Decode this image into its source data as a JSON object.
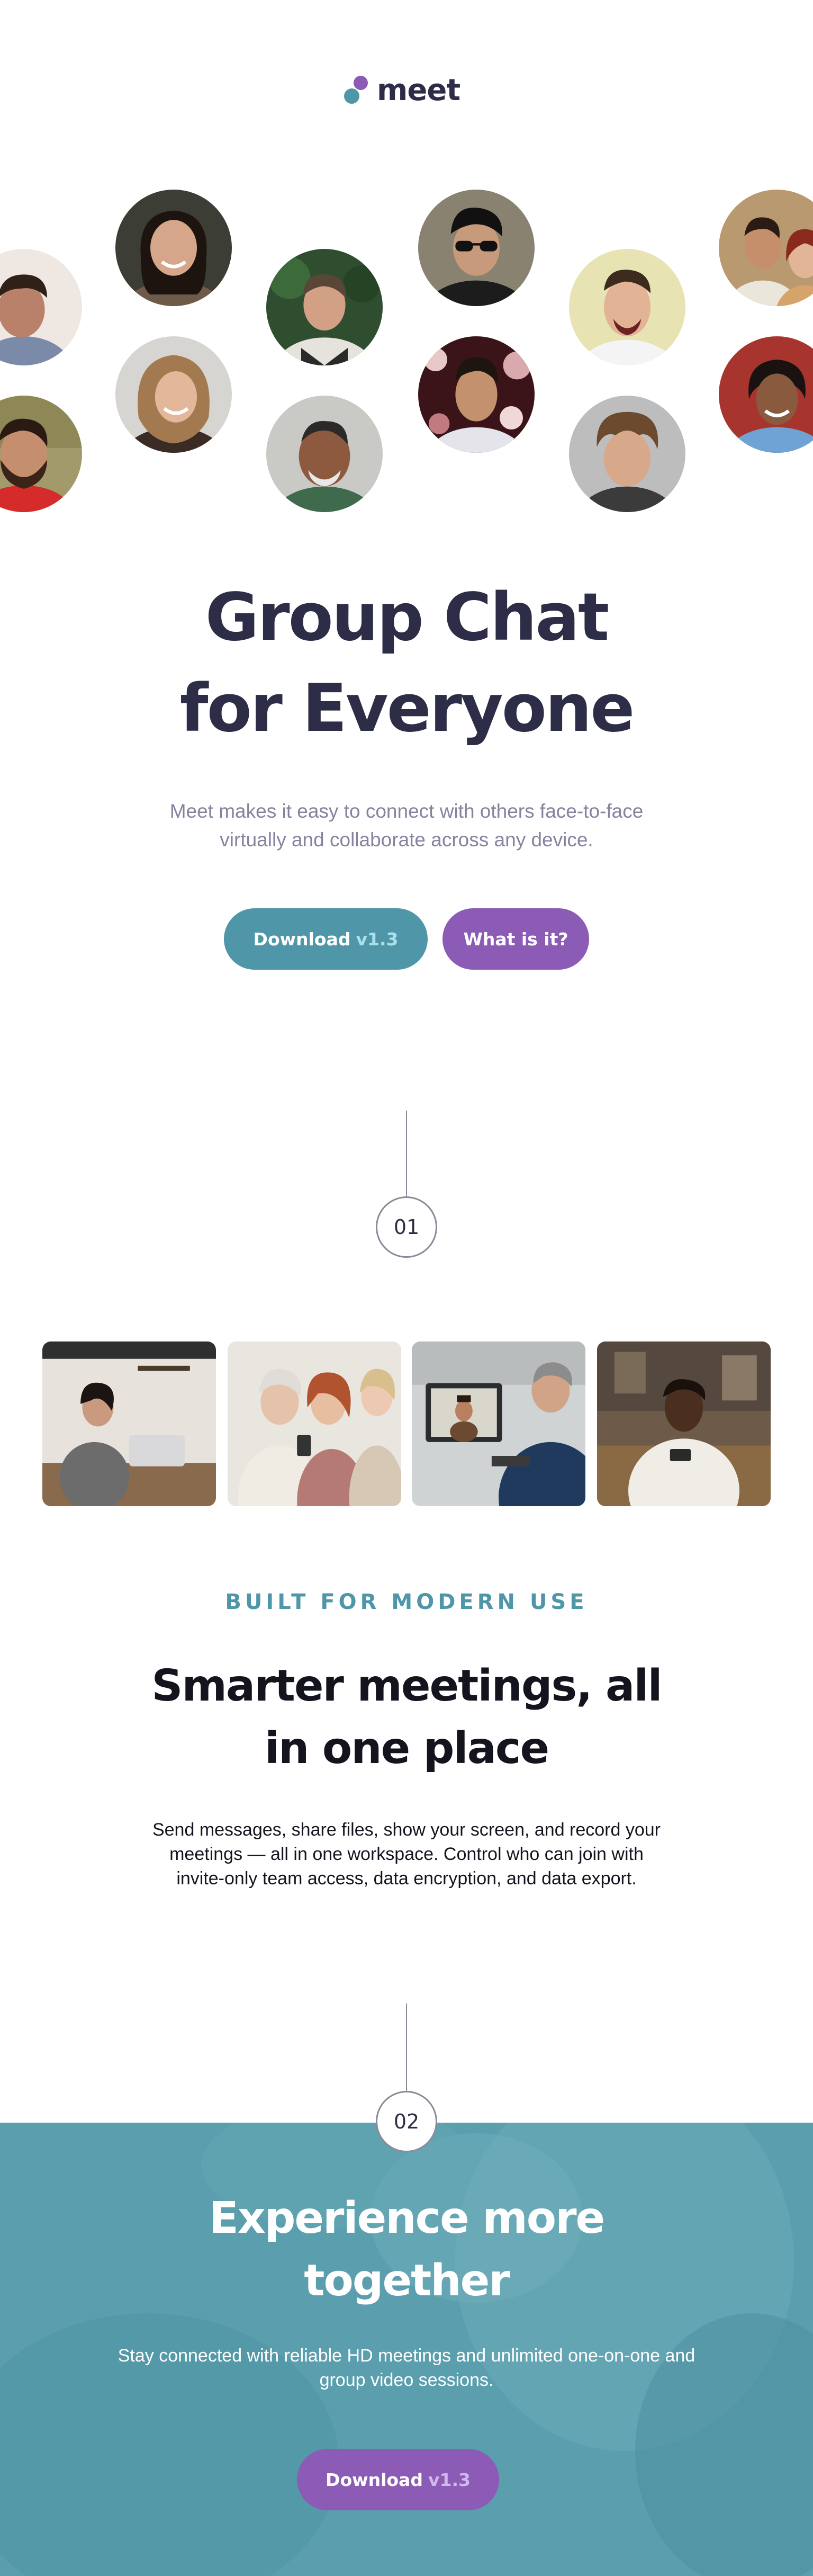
{
  "brand": {
    "name": "meet",
    "colors": {
      "teal": "#4f97a8",
      "purple": "#8b5bb5",
      "dark": "#2d2d47",
      "muted": "#86839e"
    }
  },
  "avatars": [
    {
      "name": "avatar-boy-left"
    },
    {
      "name": "avatar-bearded-man-left"
    },
    {
      "name": "avatar-woman-smiling"
    },
    {
      "name": "avatar-woman-blonde"
    },
    {
      "name": "avatar-man-green-background"
    },
    {
      "name": "avatar-older-man-smiling"
    },
    {
      "name": "avatar-man-sunglasses"
    },
    {
      "name": "avatar-man-flowers"
    },
    {
      "name": "avatar-man-laughing"
    },
    {
      "name": "avatar-man-curly-hair"
    },
    {
      "name": "avatar-couple-selfie"
    },
    {
      "name": "avatar-woman-red-background"
    }
  ],
  "hero": {
    "title_line1": "Group Chat",
    "title_line2": "for Everyone",
    "subtitle": "Meet makes it easy to connect with others face-to-face virtually and collaborate across any device.",
    "download_label": "Download",
    "download_version": "v1.3",
    "what_label": "What is it?"
  },
  "steps": {
    "one": "01",
    "two": "02"
  },
  "photos": [
    {
      "name": "photo-woman-laptop-kitchen"
    },
    {
      "name": "photo-women-looking-at-phone"
    },
    {
      "name": "photo-man-video-call"
    },
    {
      "name": "photo-man-couch-phone"
    }
  ],
  "features": {
    "eyebrow": "BUILT FOR MODERN USE",
    "title_line1": "Smarter meetings, all",
    "title_line2": "in one place",
    "body": "Send messages, share files, show your screen, and record your meetings — all in one workspace. Control who can join with invite-only team access, data encryption, and data export."
  },
  "experience": {
    "title_line1": "Experience more",
    "title_line2": "together",
    "body": "Stay connected with reliable HD meetings and unlimited one-on-one and group video sessions.",
    "download_label": "Download",
    "download_version": "v1.3"
  }
}
